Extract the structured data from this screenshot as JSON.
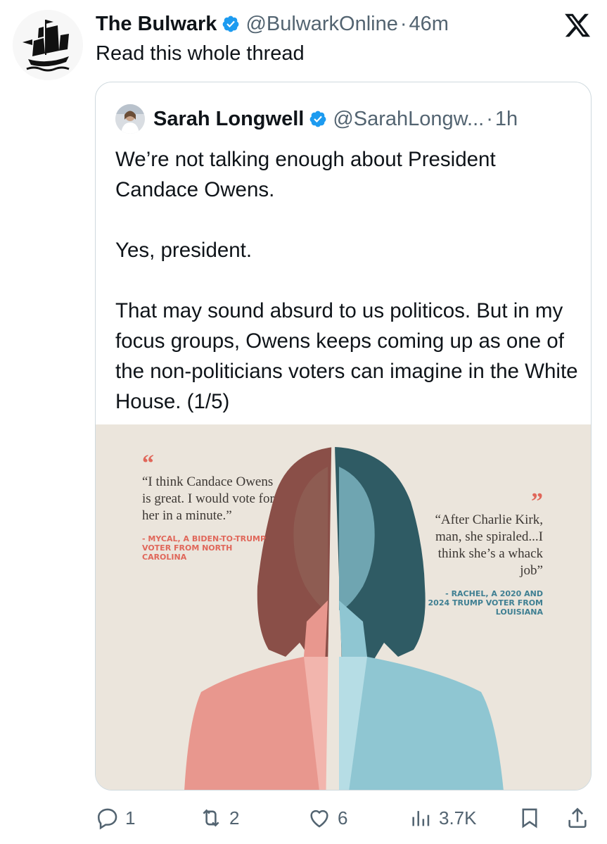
{
  "tweet": {
    "author_name": "The Bulwark",
    "handle": "@BulwarkOnline",
    "separator": "·",
    "time": "46m",
    "text": "Read this whole thread",
    "avatar_icon": "pirate-ship-icon",
    "platform_icon": "x-logo-icon"
  },
  "quoted": {
    "author_name": "Sarah Longwell",
    "handle": "@SarahLongw...",
    "separator": "·",
    "time": "1h",
    "paragraphs": [
      "We’re not talking enough about President Candace Owens.",
      "Yes, president.",
      "That may sound absurd to us politicos. But in my focus groups, Owens keeps coming up as one of the non-politicians voters can imagine in the White House. (1/5)"
    ],
    "image": {
      "left_quote": {
        "mark": "“",
        "text": "“I think Candace Owens is great. I would vote for her in a minute.”",
        "attribution": "- MYCAL, A BIDEN-TO-TRUMP VOTER FROM NORTH CAROLINA"
      },
      "right_quote": {
        "mark": "”",
        "text": "“After Charlie Kirk, man, she spiraled...I think she’s a whack job”",
        "attribution": "- RACHEL, A 2020 AND 2024 TRUMP VOTER FROM LOUISIANA"
      },
      "colors": {
        "background": "#ebe5dc",
        "left_tint": "#e8978e",
        "right_tint": "#8fc6d2",
        "accent_red": "#e0675a"
      }
    }
  },
  "actions": {
    "replies": "1",
    "reposts": "2",
    "likes": "6",
    "views": "3.7K"
  },
  "colors": {
    "verified": "#1d9bf0",
    "text_primary": "#0f1419",
    "text_secondary": "#536471",
    "border": "#cfd9de"
  }
}
